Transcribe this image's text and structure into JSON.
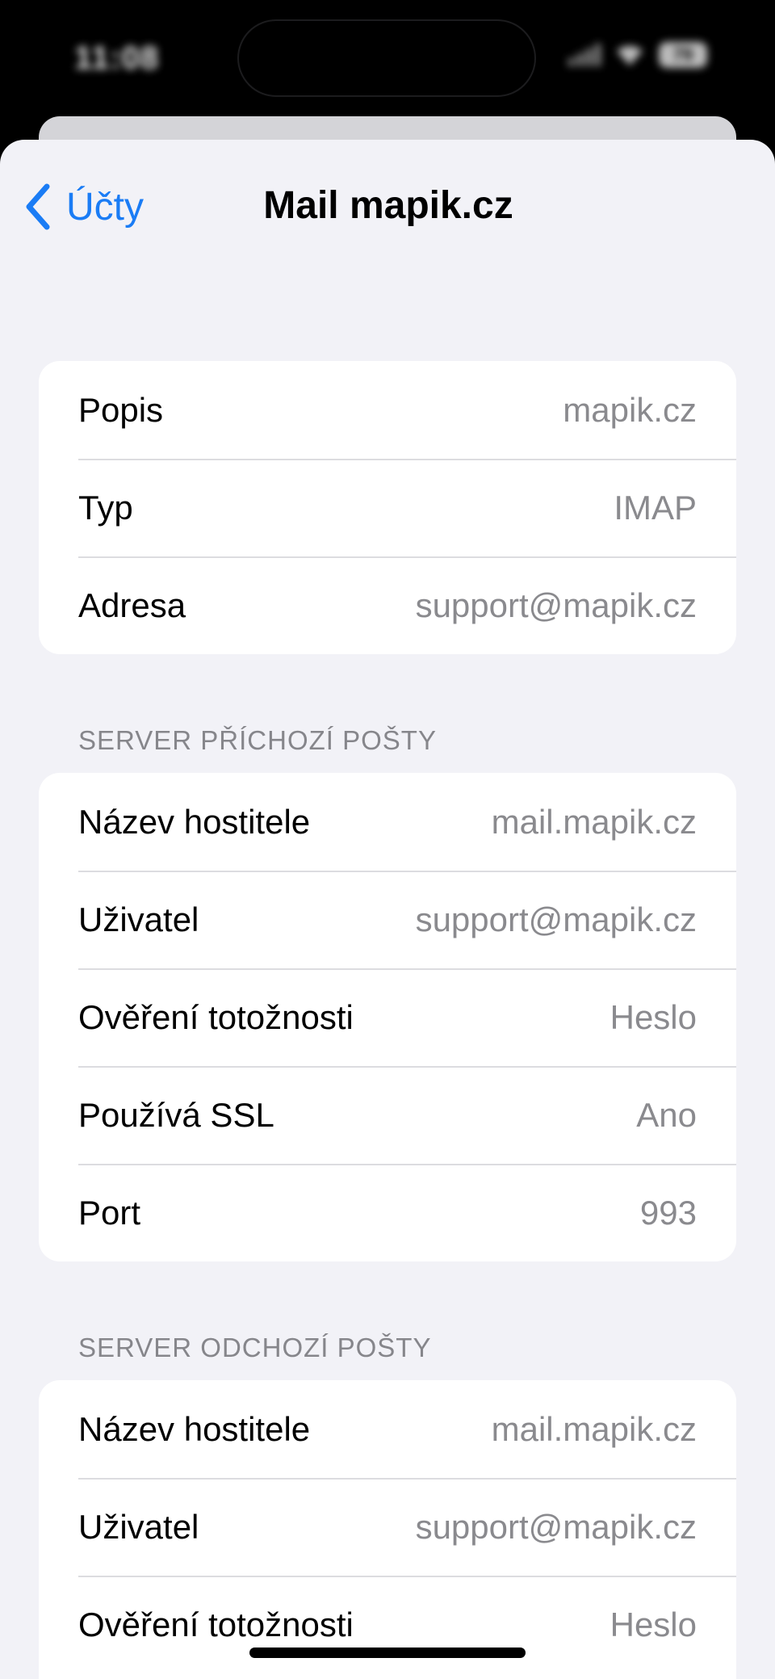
{
  "status_bar": {
    "time": "11:08",
    "battery": "79"
  },
  "nav": {
    "back_label": "Účty",
    "title": "Mail mapik.cz"
  },
  "account": {
    "rows": [
      {
        "label": "Popis",
        "value": "mapik.cz"
      },
      {
        "label": "Typ",
        "value": "IMAP"
      },
      {
        "label": "Adresa",
        "value": "support@mapik.cz"
      }
    ]
  },
  "incoming": {
    "header": "SERVER PŘÍCHOZÍ POŠTY",
    "rows": [
      {
        "label": "Název hostitele",
        "value": "mail.mapik.cz"
      },
      {
        "label": "Uživatel",
        "value": "support@mapik.cz"
      },
      {
        "label": "Ověření totožnosti",
        "value": "Heslo"
      },
      {
        "label": "Používá SSL",
        "value": "Ano"
      },
      {
        "label": "Port",
        "value": "993"
      }
    ]
  },
  "outgoing": {
    "header": "SERVER ODCHOZÍ POŠTY",
    "rows": [
      {
        "label": "Název hostitele",
        "value": "mail.mapik.cz"
      },
      {
        "label": "Uživatel",
        "value": "support@mapik.cz"
      },
      {
        "label": "Ověření totožnosti",
        "value": "Heslo"
      }
    ]
  },
  "colors": {
    "accent": "#1a7cf5",
    "background": "#f2f2f7",
    "secondary_text": "#8a8a8e"
  }
}
